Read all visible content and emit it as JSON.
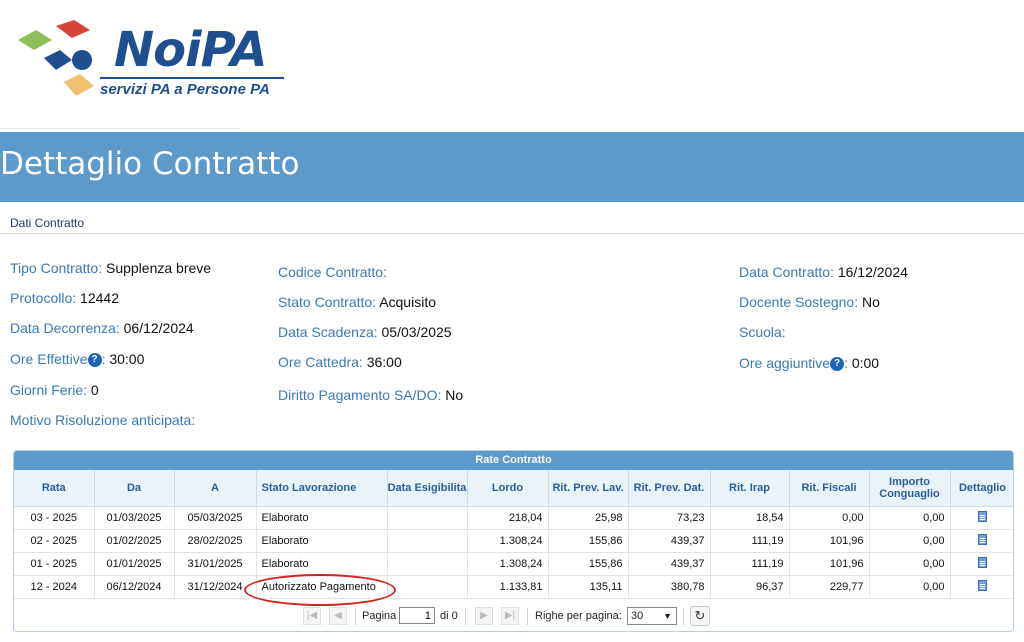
{
  "logo": {
    "name": "NoiPA",
    "tagline": "servizi PA a Persone PA"
  },
  "page": {
    "title": "Dettaglio Contratto",
    "section": "Dati Contratto"
  },
  "fields": {
    "tipo_contratto": {
      "label": "Tipo Contratto:",
      "value": "Supplenza breve"
    },
    "protocollo": {
      "label": "Protocollo:",
      "value": "12442"
    },
    "data_decorrenza": {
      "label": "Data Decorrenza:",
      "value": "06/12/2024"
    },
    "ore_effettive": {
      "label": "Ore Effettive",
      "value": "30:00"
    },
    "giorni_ferie": {
      "label": "Giorni Ferie:",
      "value": "0"
    },
    "motivo_risoluzione": {
      "label": "Motivo Risoluzione anticipata:",
      "value": ""
    },
    "codice_contratto": {
      "label": "Codice Contratto:",
      "value": ""
    },
    "stato_contratto": {
      "label": "Stato Contratto:",
      "value": "Acquisito"
    },
    "data_scadenza": {
      "label": "Data Scadenza:",
      "value": "05/03/2025"
    },
    "ore_cattedra": {
      "label": "Ore Cattedra:",
      "value": "36:00"
    },
    "diritto_pagamento": {
      "label": "Diritto Pagamento SA/DO:",
      "value": "No"
    },
    "data_contratto": {
      "label": "Data Contratto:",
      "value": "16/12/2024"
    },
    "docente_sostegno": {
      "label": "Docente Sostegno:",
      "value": "No"
    },
    "scuola": {
      "label": "Scuola:",
      "value": ""
    },
    "ore_aggiuntive": {
      "label": "Ore aggiuntive",
      "value": "0:00"
    }
  },
  "grid": {
    "caption": "Rate Contratto",
    "columns": [
      "Rata",
      "Da",
      "A",
      "Stato Lavorazione",
      "Data Esigibilita",
      "Lordo",
      "Rit. Prev. Lav.",
      "Rit. Prev. Dat.",
      "Rit. Irap",
      "Rit. Fiscali",
      "Importo Conguaglio",
      "Dettaglio"
    ],
    "rows": [
      [
        "03 - 2025",
        "01/03/2025",
        "05/03/2025",
        "Elaborato",
        "",
        "218,04",
        "25,98",
        "73,23",
        "18,54",
        "0,00",
        "0,00"
      ],
      [
        "02 - 2025",
        "01/02/2025",
        "28/02/2025",
        "Elaborato",
        "",
        "1.308,24",
        "155,86",
        "439,37",
        "111,19",
        "101,96",
        "0,00"
      ],
      [
        "01 - 2025",
        "01/01/2025",
        "31/01/2025",
        "Elaborato",
        "",
        "1.308,24",
        "155,86",
        "439,37",
        "111,19",
        "101,96",
        "0,00"
      ],
      [
        "12 - 2024",
        "06/12/2024",
        "31/12/2024",
        "Autorizzato Pagamento",
        "",
        "1.133,81",
        "135,11",
        "380,78",
        "96,37",
        "229,77",
        "0,00"
      ]
    ]
  },
  "pager": {
    "page_label": "Pagina",
    "page_value": "1",
    "of_label": "di 0",
    "rows_label": "Righe per pagina:",
    "rows_value": "30"
  },
  "colors": {
    "accent": "#5b9acb",
    "label": "#3b79b6",
    "brand": "#1f4f8f",
    "highlight": "#d42020"
  }
}
